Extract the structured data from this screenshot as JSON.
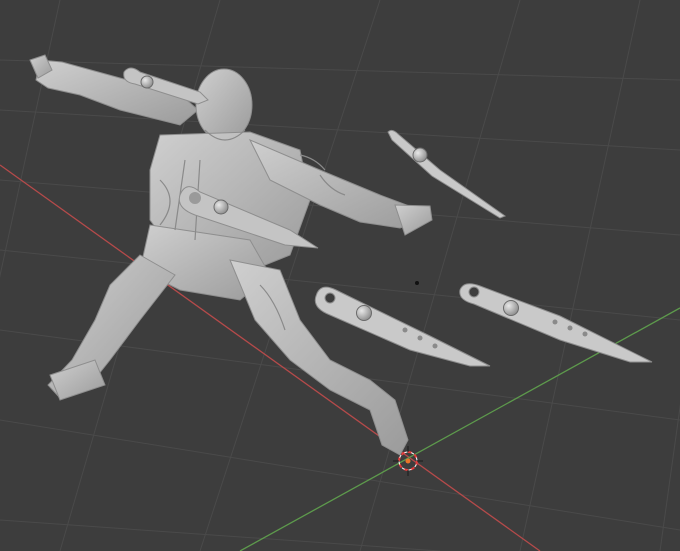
{
  "viewport": {
    "background_color": "#3d3d3d",
    "grid_color": "#4a4a4a",
    "x_axis_color": "#b54a4a",
    "y_axis_color": "#5d9a4c",
    "model_color": "#b9b9b9",
    "model_shadow_color": "#8e8e8e",
    "gizmo_color": "#d9d9d9",
    "origin_color": "#e8742a",
    "cursor_color": "#e23c3c"
  },
  "scene": {
    "objects": [
      {
        "name": "character-figure",
        "kind": "sculpt-mesh"
      },
      {
        "name": "kunai-on-arm",
        "kind": "mesh"
      },
      {
        "name": "kunai-on-chest",
        "kind": "mesh"
      },
      {
        "name": "kunai-flying-edge-on",
        "kind": "mesh"
      },
      {
        "name": "kunai-flying-left",
        "kind": "mesh"
      },
      {
        "name": "kunai-flying-right",
        "kind": "mesh"
      }
    ],
    "icons": {
      "origin": "object-origin-icon",
      "cursor": "3d-cursor-icon",
      "pivot": "pivot-dot-icon"
    }
  }
}
